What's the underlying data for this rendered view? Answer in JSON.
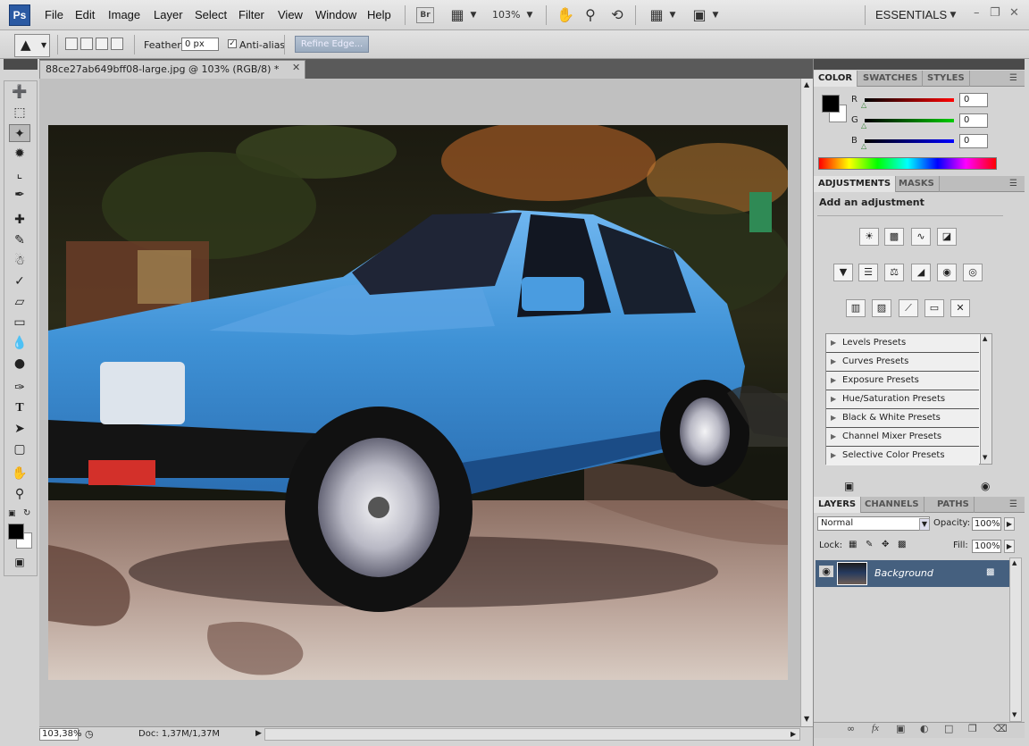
{
  "app": {
    "logo": "Ps",
    "menu": [
      "File",
      "Edit",
      "Image",
      "Layer",
      "Select",
      "Filter",
      "View",
      "Window",
      "Help"
    ],
    "bridge_label": "Br",
    "zoom_level": "103%",
    "workspace": "ESSENTIALS"
  },
  "options": {
    "feather_label": "Feather:",
    "feather_value": "0 px",
    "antialias_label": "Anti-alias",
    "antialias_checked": true,
    "refine_edge_label": "Refine Edge..."
  },
  "document": {
    "tab_title": "88ce27ab649bff08-large.jpg @ 103% (RGB/8) *",
    "status_zoom": "103,38%",
    "status_doc": "Doc: 1,37M/1,37M"
  },
  "color_panel": {
    "tabs": [
      "COLOR",
      "SWATCHES",
      "STYLES"
    ],
    "channels": [
      {
        "label": "R",
        "value": "0",
        "color": "#e00000"
      },
      {
        "label": "G",
        "value": "0",
        "color": "#00c000"
      },
      {
        "label": "B",
        "value": "0",
        "color": "#0000e0"
      }
    ]
  },
  "adjustments_panel": {
    "tabs": [
      "ADJUSTMENTS",
      "MASKS"
    ],
    "heading": "Add an adjustment",
    "presets": [
      "Levels Presets",
      "Curves Presets",
      "Exposure Presets",
      "Hue/Saturation Presets",
      "Black & White Presets",
      "Channel Mixer Presets",
      "Selective Color Presets"
    ]
  },
  "layers_panel": {
    "tabs": [
      "LAYERS",
      "CHANNELS",
      "PATHS"
    ],
    "blend_mode": "Normal",
    "opacity_label": "Opacity:",
    "opacity_value": "100%",
    "lock_label": "Lock:",
    "fill_label": "Fill:",
    "fill_value": "100%",
    "layers": [
      {
        "name": "Background",
        "visible": true,
        "locked": true
      }
    ]
  }
}
